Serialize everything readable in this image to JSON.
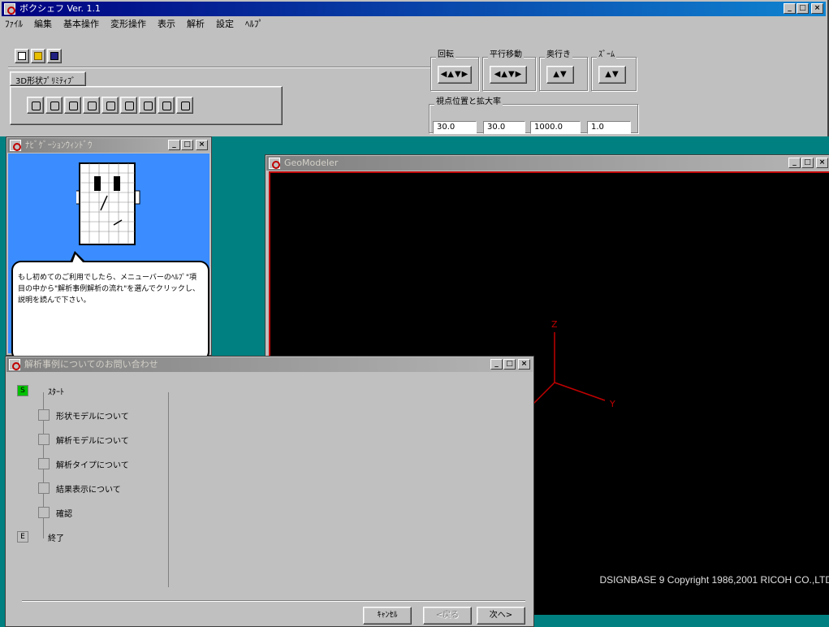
{
  "app": {
    "title": "ボクシェフ Ver. 1.1"
  },
  "menu": [
    "ﾌｧｲﾙ",
    "編集",
    "基本操作",
    "変形操作",
    "表示",
    "解析",
    "設定",
    "ﾍﾙﾌﾟ"
  ],
  "toolbar": {
    "new_icon": "new-file-icon",
    "open_icon": "open-folder-icon",
    "save_icon": "save-disk-icon"
  },
  "shape_tab": {
    "label": "3D形状ﾌﾟﾘﾐﾃｨﾌﾞ"
  },
  "transform": {
    "rotate_label": "回転",
    "translate_label": "平行移動",
    "depth_label": "奥行き",
    "zoom_label": "ｽﾞｰﾑ"
  },
  "view_settings": {
    "label": "視点位置と拡大率",
    "values": [
      "30.0",
      "30.0",
      "1000.0",
      "1.0"
    ]
  },
  "navigator": {
    "title": "ﾅﾋﾞｹﾞｰｼｮﾝｳｨﾝﾄﾞｳ",
    "message": "もし初めてのご利用でしたら、メニューバーのﾍﾙﾌﾟ\"項目の中から\"解析事例解析の流れ\"を選んでクリックし、説明を読んで下さい。"
  },
  "modeler": {
    "title": "GeoModeler",
    "copyright": "DSIGNBASE 9    Copyright 1986,2001 RICOH CO.,LTD",
    "axis_z": "Z",
    "axis_y": "Y"
  },
  "wizard": {
    "title": "解析事例についてのお問い合わせ",
    "steps": [
      {
        "label": "ｽﾀｰﾄ",
        "active": true,
        "marker": "S"
      },
      {
        "label": "形状モデルについて",
        "active": false,
        "marker": ""
      },
      {
        "label": "解析モデルについて",
        "active": false,
        "marker": ""
      },
      {
        "label": "解析タイプについて",
        "active": false,
        "marker": ""
      },
      {
        "label": "結果表示について",
        "active": false,
        "marker": ""
      },
      {
        "label": "確認",
        "active": false,
        "marker": ""
      },
      {
        "label": "終了",
        "active": false,
        "marker": "E"
      }
    ],
    "buttons": {
      "cancel": "ｷｬﾝｾﾙ",
      "back": "<戻る",
      "next": "次へ>"
    }
  },
  "colors": {
    "desktop": "#008080",
    "titlebar": "#000080",
    "navigator_bg": "#3a8cff",
    "axis": "#c00000",
    "step_active": "#00c000"
  }
}
